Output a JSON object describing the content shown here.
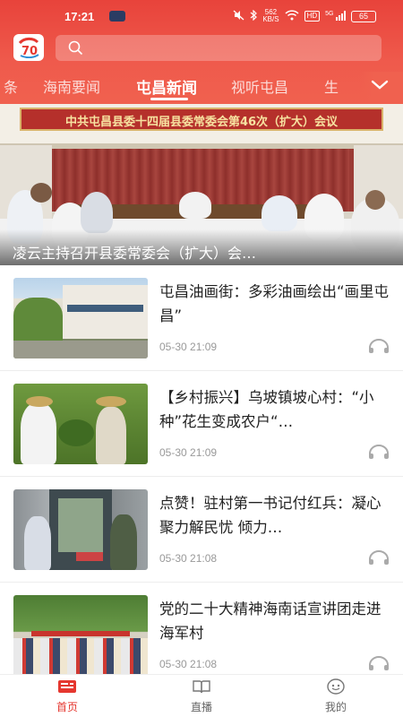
{
  "status_bar": {
    "time": "17:21",
    "network_speed_top": "562",
    "network_speed_bottom": "KB/S",
    "hd_badge": "HD",
    "signal_label": "5G",
    "battery": "65"
  },
  "header": {
    "logo_icon": "app-logo-icon",
    "search_placeholder": "",
    "search_icon": "search-icon"
  },
  "tabs": [
    {
      "label": "条",
      "active": false
    },
    {
      "label": "海南要闻",
      "active": false
    },
    {
      "label": "屯昌新闻",
      "active": true
    },
    {
      "label": "视听屯昌",
      "active": false
    },
    {
      "label": "生",
      "active": false
    }
  ],
  "banner": {
    "sign_text": "中共屯昌县委十四届县委常委会第46次（扩大）会议",
    "caption": "凌云主持召开县委常委会（扩大）会…"
  },
  "news": [
    {
      "title": "屯昌油画街：多彩油画绘出“画里屯昌”",
      "time": "05-30 21:09"
    },
    {
      "title": "【乡村振兴】乌坡镇坡心村：“小种”花生变成农户“…",
      "time": "05-30 21:09"
    },
    {
      "title": "点赞！驻村第一书记付红兵：凝心聚力解民忧 倾力…",
      "time": "05-30 21:08"
    },
    {
      "title": "党的二十大精神海南话宣讲团走进海军村",
      "time": "05-30 21:08"
    }
  ],
  "bottom_nav": [
    {
      "label": "首页",
      "icon": "home-news-icon",
      "active": true
    },
    {
      "label": "直播",
      "icon": "live-book-icon",
      "active": false
    },
    {
      "label": "我的",
      "icon": "profile-icon",
      "active": false
    }
  ],
  "colors": {
    "brand_red": "#e8433b",
    "active_nav": "#e5372f"
  }
}
